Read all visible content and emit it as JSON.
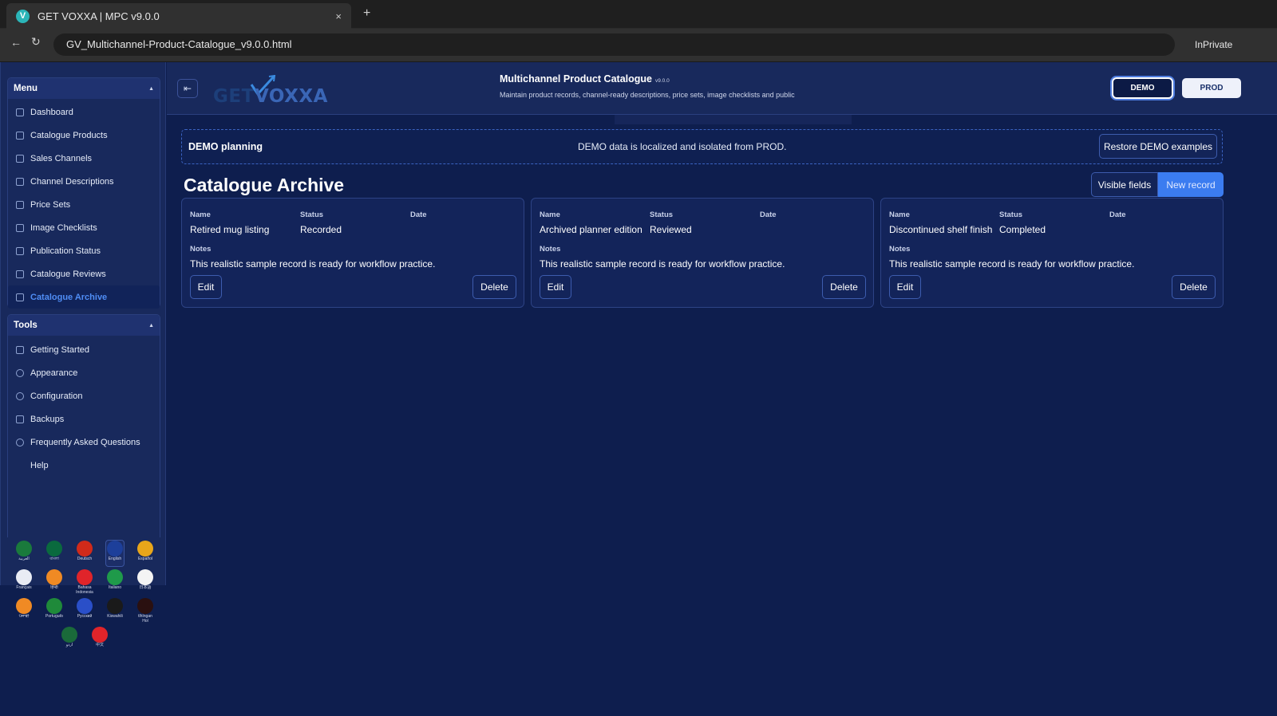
{
  "browser": {
    "tab_title": "GET VOXXA | MPC v9.0.0",
    "favicon": "V",
    "tab_close": "×",
    "new_tab": "+",
    "back": "←",
    "reload": "↻",
    "url": "GV_Multichannel-Product-Catalogue_v9.0.0.html",
    "inprivate": "InPrivate"
  },
  "sidebar": {
    "menu_title": "Menu",
    "menu_items": [
      {
        "label": "Dashboard",
        "active": false
      },
      {
        "label": "Catalogue Products",
        "active": false
      },
      {
        "label": "Sales Channels",
        "active": false
      },
      {
        "label": "Channel Descriptions",
        "active": false
      },
      {
        "label": "Price Sets",
        "active": false
      },
      {
        "label": "Image Checklists",
        "active": false
      },
      {
        "label": "Publication Status",
        "active": false
      },
      {
        "label": "Catalogue Reviews",
        "active": false
      },
      {
        "label": "Catalogue Archive",
        "active": true
      }
    ],
    "tools_title": "Tools",
    "tools_items": [
      {
        "label": "Getting Started",
        "icon": "flag-icon"
      },
      {
        "label": "Appearance",
        "icon": "palette-icon"
      },
      {
        "label": "Configuration",
        "icon": "gear-icon"
      },
      {
        "label": "Backups",
        "icon": "upload-icon"
      },
      {
        "label": "Frequently Asked Questions",
        "icon": "question-icon"
      },
      {
        "label": "Help",
        "icon": "none"
      }
    ],
    "languages": [
      [
        {
          "label": "العربية",
          "color": "#1a7a3c"
        },
        {
          "label": "বাংলা",
          "color": "#0a6a3e"
        },
        {
          "label": "Deutsch",
          "color": "#d12a1a"
        },
        {
          "label": "English",
          "color": "#1d3f9a",
          "selected": true
        },
        {
          "label": "Español",
          "color": "#e8a61a"
        }
      ],
      [
        {
          "label": "Français",
          "color": "#e9ecf4"
        },
        {
          "label": "हिन्दी",
          "color": "#f08a24"
        },
        {
          "label": "Bahasa Indonesia",
          "color": "#e0242a"
        },
        {
          "label": "Italiano",
          "color": "#1f9a4a"
        },
        {
          "label": "日本語",
          "color": "#f4f4f4"
        }
      ],
      [
        {
          "label": "ਪੰਜਾਬੀ",
          "color": "#f08a24"
        },
        {
          "label": "Português",
          "color": "#1f8a3a"
        },
        {
          "label": "Русский",
          "color": "#2a4fc8"
        },
        {
          "label": "Kiswahili",
          "color": "#1a1a1a"
        },
        {
          "label": "tlhIngan Hol",
          "color": "#2a1010"
        }
      ],
      [
        {
          "label": "اردو",
          "color": "#1a6a3a"
        },
        {
          "label": "中文",
          "color": "#e0242a"
        }
      ]
    ]
  },
  "header": {
    "toggle_icon": "⇤",
    "logo_get": "GET",
    "logo_voxxa": "VOXXA",
    "title": "Multichannel Product Catalogue",
    "version": "v9.0.0",
    "subtitle": "Maintain product records, channel-ready descriptions, price sets, image checklists and public",
    "demo_label": "DEMO",
    "prod_label": "PROD"
  },
  "banner": {
    "title": "DEMO planning",
    "message": "DEMO data is localized and isolated from PROD.",
    "restore_label": "Restore DEMO examples"
  },
  "main": {
    "page_title": "Catalogue Archive",
    "visible_fields_label": "Visible fields",
    "new_record_label": "New record"
  },
  "records": [
    {
      "name_label": "Name",
      "status_label": "Status",
      "date_label": "Date",
      "name": "Retired mug listing",
      "status": "Recorded",
      "notes_label": "Notes",
      "notes": "This realistic sample record is ready for workflow practice.",
      "edit_label": "Edit",
      "delete_label": "Delete"
    },
    {
      "name_label": "Name",
      "status_label": "Status",
      "date_label": "Date",
      "name": "Archived planner edition",
      "status": "Reviewed",
      "notes_label": "Notes",
      "notes": "This realistic sample record is ready for workflow practice.",
      "edit_label": "Edit",
      "delete_label": "Delete"
    },
    {
      "name_label": "Name",
      "status_label": "Status",
      "date_label": "Date",
      "name": "Discontinued shelf finish",
      "status": "Completed",
      "notes_label": "Notes",
      "notes": "This realistic sample record is ready for workflow practice.",
      "edit_label": "Edit",
      "delete_label": "Delete"
    }
  ]
}
